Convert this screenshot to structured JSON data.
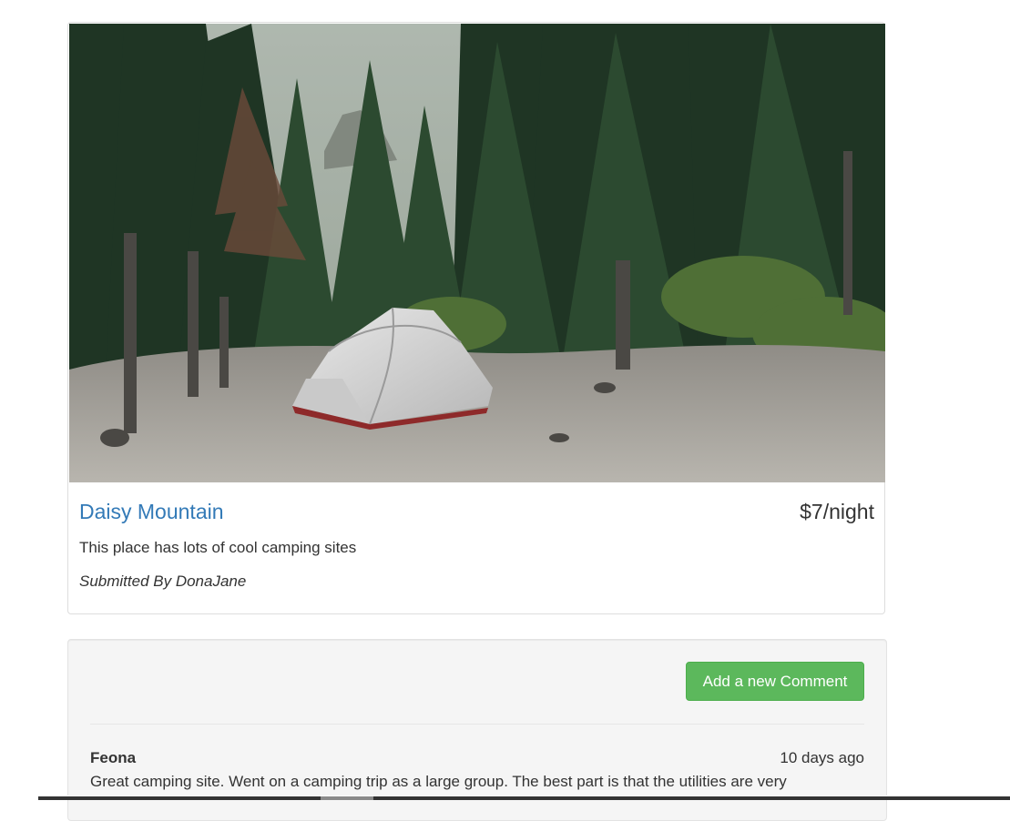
{
  "campground": {
    "image_icon": "camping-tent-forest-photo",
    "name": "Daisy Mountain",
    "price": "$7/night",
    "description": "This place has lots of cool camping sites",
    "submitted_by": "Submitted By DonaJane"
  },
  "comments_section": {
    "add_button_label": "Add a new Comment",
    "comments": [
      {
        "author": "Feona",
        "time": "10 days ago",
        "text": "Great camping site. Went on a camping trip as a large group. The best part is that the utilities are very"
      }
    ]
  },
  "colors": {
    "link": "#337ab7",
    "success_button": "#5cb85c",
    "well_background": "#f5f5f5"
  }
}
